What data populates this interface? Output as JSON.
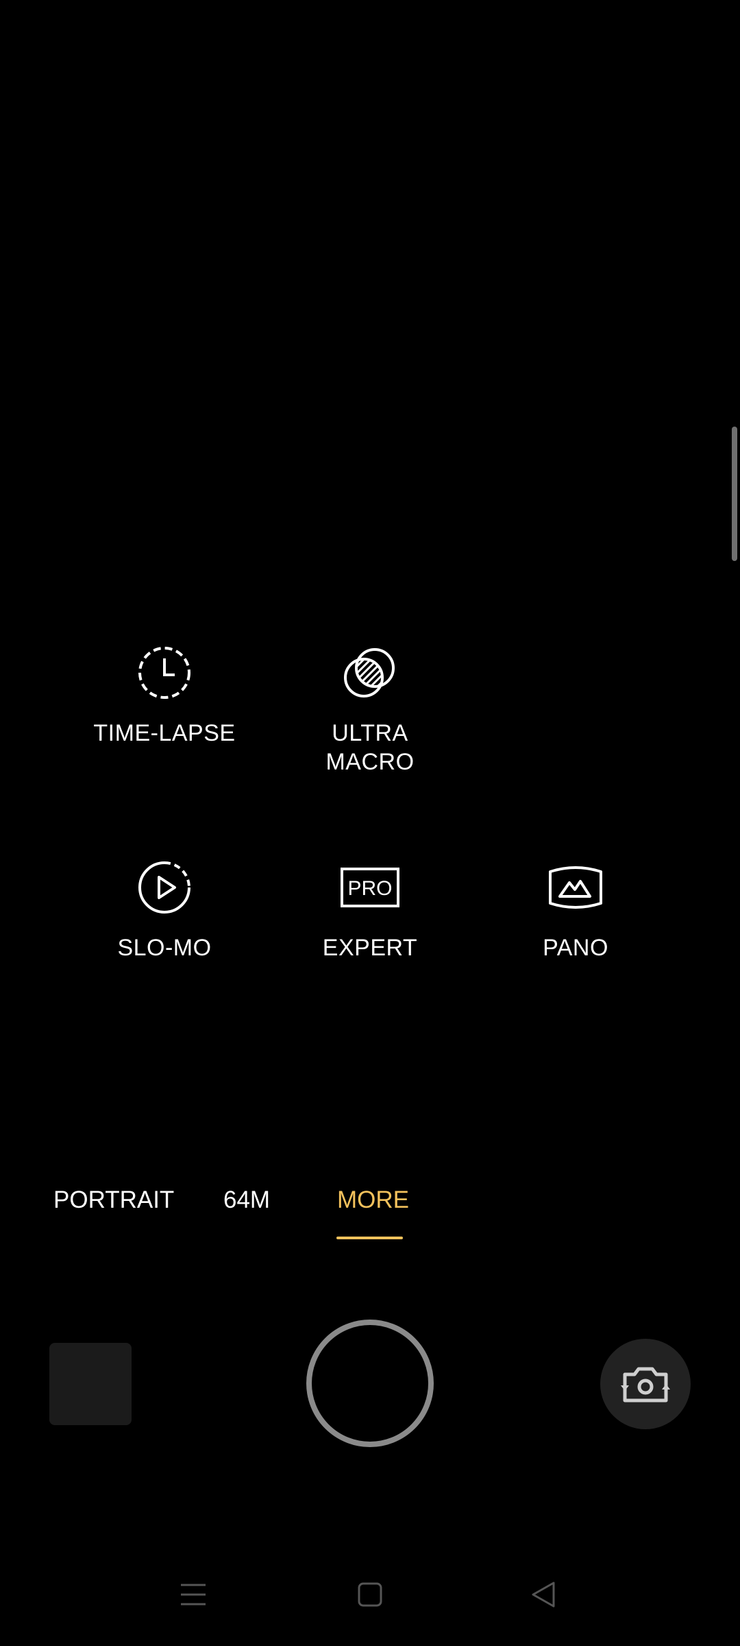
{
  "modes": [
    {
      "label": "TIME-LAPSE",
      "icon": "time-lapse-icon"
    },
    {
      "label": "ULTRA\nMACRO",
      "icon": "ultra-macro-icon"
    },
    {
      "label": "SLO-MO",
      "icon": "slo-mo-icon"
    },
    {
      "label": "EXPERT",
      "icon": "expert-pro-icon",
      "icon_text": "PRO"
    },
    {
      "label": "PANO",
      "icon": "pano-icon"
    }
  ],
  "tabs": [
    {
      "label": "PORTRAIT",
      "active": false
    },
    {
      "label": "64M",
      "active": false
    },
    {
      "label": "MORE",
      "active": true
    }
  ],
  "controls": {
    "gallery": "gallery-thumbnail",
    "shutter": "shutter-button",
    "flip": "switch-camera-icon"
  },
  "nav": [
    "menu-icon",
    "home-icon",
    "back-icon"
  ],
  "colors": {
    "background": "#000000",
    "accent": "#f4c25c",
    "text": "#ffffff"
  }
}
